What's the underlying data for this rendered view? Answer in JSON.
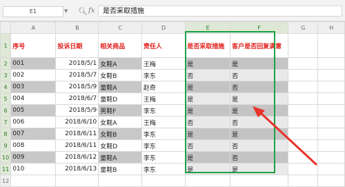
{
  "formula_bar": {
    "name_box": "E1",
    "zoom_icon": "magnifier-icon",
    "fx_label": "fx",
    "formula": "是否采取措施"
  },
  "columns": [
    "A",
    "B",
    "C",
    "D",
    "E",
    "F",
    "G",
    "H"
  ],
  "headers": [
    "序号",
    "投诉日期",
    "相关商品",
    "责任人",
    "是否采取措施",
    "客户是否回复满意"
  ],
  "rows": [
    {
      "n": "2",
      "a": "001",
      "b": "2018/5/1",
      "c": "女鞋A",
      "d": "王梅",
      "e": "是",
      "f": "是"
    },
    {
      "n": "3",
      "a": "002",
      "b": "2018/5/7",
      "c": "女鞋B",
      "d": "李东",
      "e": "否",
      "f": "否"
    },
    {
      "n": "4",
      "a": "003",
      "b": "2018/5/9",
      "c": "童鞋A",
      "d": "赵奇",
      "e": "是",
      "f": "否"
    },
    {
      "n": "5",
      "a": "004",
      "b": "2018/6/7",
      "c": "童鞋D",
      "d": "王梅",
      "e": "是",
      "f": "是"
    },
    {
      "n": "6",
      "a": "005",
      "b": "2018/5/9",
      "c": "男鞋F",
      "d": "李东",
      "e": "是",
      "f": "是"
    },
    {
      "n": "7",
      "a": "006",
      "b": "2018/6/10",
      "c": "女鞋A",
      "d": "王梅",
      "e": "否",
      "f": "否"
    },
    {
      "n": "8",
      "a": "007",
      "b": "2018/6/11",
      "c": "女鞋B",
      "d": "李东",
      "e": "是",
      "f": "是"
    },
    {
      "n": "9",
      "a": "008",
      "b": "2018/6/11",
      "c": "女鞋D",
      "d": "李东",
      "e": "否",
      "f": "否"
    },
    {
      "n": "10",
      "a": "009",
      "b": "2018/6/12",
      "c": "童鞋A",
      "d": "李东",
      "e": "是",
      "f": "否"
    },
    {
      "n": "11",
      "a": "010",
      "b": "2018/6/13",
      "c": "童鞋B",
      "d": "李东",
      "e": "是",
      "f": "是"
    }
  ],
  "extra_row": "12",
  "accent": {
    "selection": "#1fa045",
    "header_text": "#e0201c",
    "arrow": "#e8332a"
  }
}
